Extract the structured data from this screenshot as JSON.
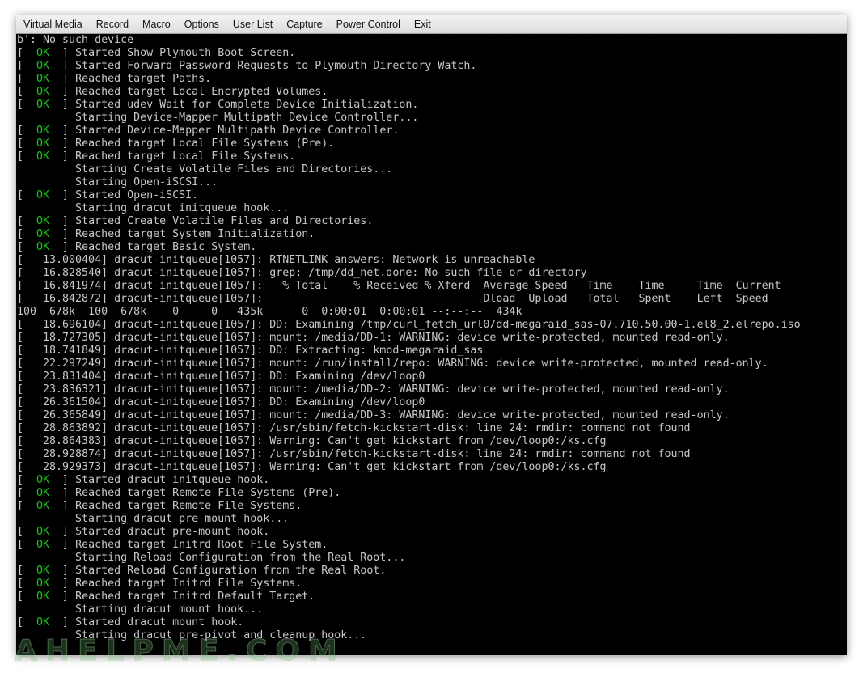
{
  "menu": [
    "Virtual Media",
    "Record",
    "Macro",
    "Options",
    "User List",
    "Capture",
    "Power Control",
    "Exit"
  ],
  "ok_label": "OK",
  "colors": {
    "ok": "#1fc01f",
    "text": "#c8c8c8",
    "background": "#000000"
  },
  "console_lines": [
    {
      "status": null,
      "text": "b': No such device"
    },
    {
      "status": "OK",
      "text": "Started Show Plymouth Boot Screen."
    },
    {
      "status": "OK",
      "text": "Started Forward Password Requests to Plymouth Directory Watch."
    },
    {
      "status": "OK",
      "text": "Reached target Paths."
    },
    {
      "status": "OK",
      "text": "Reached target Local Encrypted Volumes."
    },
    {
      "status": "OK",
      "text": "Started udev Wait for Complete Device Initialization."
    },
    {
      "status": null,
      "text": "         Starting Device-Mapper Multipath Device Controller..."
    },
    {
      "status": "OK",
      "text": "Started Device-Mapper Multipath Device Controller."
    },
    {
      "status": "OK",
      "text": "Reached target Local File Systems (Pre)."
    },
    {
      "status": "OK",
      "text": "Reached target Local File Systems."
    },
    {
      "status": null,
      "text": "         Starting Create Volatile Files and Directories..."
    },
    {
      "status": null,
      "text": "         Starting Open-iSCSI..."
    },
    {
      "status": "OK",
      "text": "Started Open-iSCSI."
    },
    {
      "status": null,
      "text": "         Starting dracut initqueue hook..."
    },
    {
      "status": "OK",
      "text": "Started Create Volatile Files and Directories."
    },
    {
      "status": "OK",
      "text": "Reached target System Initialization."
    },
    {
      "status": "OK",
      "text": "Reached target Basic System."
    },
    {
      "status": null,
      "text": "[   13.000404] dracut-initqueue[1057]: RTNETLINK answers: Network is unreachable"
    },
    {
      "status": null,
      "text": "[   16.828540] dracut-initqueue[1057]: grep: /tmp/dd_net.done: No such file or directory"
    },
    {
      "status": null,
      "text": "[   16.841974] dracut-initqueue[1057]:   % Total    % Received % Xferd  Average Speed   Time    Time     Time  Current"
    },
    {
      "status": null,
      "text": "[   16.842872] dracut-initqueue[1057]:                                  Dload  Upload   Total   Spent    Left  Speed"
    },
    {
      "status": null,
      "text": "100  678k  100  678k    0     0   435k      0  0:00:01  0:00:01 --:--:--  434k"
    },
    {
      "status": null,
      "text": "[   18.696104] dracut-initqueue[1057]: DD: Examining /tmp/curl_fetch_url0/dd-megaraid_sas-07.710.50.00-1.el8_2.elrepo.iso"
    },
    {
      "status": null,
      "text": "[   18.727305] dracut-initqueue[1057]: mount: /media/DD-1: WARNING: device write-protected, mounted read-only."
    },
    {
      "status": null,
      "text": "[   18.741849] dracut-initqueue[1057]: DD: Extracting: kmod-megaraid_sas"
    },
    {
      "status": null,
      "text": "[   22.297249] dracut-initqueue[1057]: mount: /run/install/repo: WARNING: device write-protected, mounted read-only."
    },
    {
      "status": null,
      "text": "[   23.831404] dracut-initqueue[1057]: DD: Examining /dev/loop0"
    },
    {
      "status": null,
      "text": "[   23.836321] dracut-initqueue[1057]: mount: /media/DD-2: WARNING: device write-protected, mounted read-only."
    },
    {
      "status": null,
      "text": "[   26.361504] dracut-initqueue[1057]: DD: Examining /dev/loop0"
    },
    {
      "status": null,
      "text": "[   26.365849] dracut-initqueue[1057]: mount: /media/DD-3: WARNING: device write-protected, mounted read-only."
    },
    {
      "status": null,
      "text": "[   28.863892] dracut-initqueue[1057]: /usr/sbin/fetch-kickstart-disk: line 24: rmdir: command not found"
    },
    {
      "status": null,
      "text": "[   28.864383] dracut-initqueue[1057]: Warning: Can't get kickstart from /dev/loop0:/ks.cfg"
    },
    {
      "status": null,
      "text": "[   28.928874] dracut-initqueue[1057]: /usr/sbin/fetch-kickstart-disk: line 24: rmdir: command not found"
    },
    {
      "status": null,
      "text": "[   28.929373] dracut-initqueue[1057]: Warning: Can't get kickstart from /dev/loop0:/ks.cfg"
    },
    {
      "status": "OK",
      "text": "Started dracut initqueue hook."
    },
    {
      "status": "OK",
      "text": "Reached target Remote File Systems (Pre)."
    },
    {
      "status": "OK",
      "text": "Reached target Remote File Systems."
    },
    {
      "status": null,
      "text": "         Starting dracut pre-mount hook..."
    },
    {
      "status": "OK",
      "text": "Started dracut pre-mount hook."
    },
    {
      "status": "OK",
      "text": "Reached target Initrd Root File System."
    },
    {
      "status": null,
      "text": "         Starting Reload Configuration from the Real Root..."
    },
    {
      "status": "OK",
      "text": "Started Reload Configuration from the Real Root."
    },
    {
      "status": "OK",
      "text": "Reached target Initrd File Systems."
    },
    {
      "status": "OK",
      "text": "Reached target Initrd Default Target."
    },
    {
      "status": null,
      "text": "         Starting dracut mount hook..."
    },
    {
      "status": "OK",
      "text": "Started dracut mount hook."
    },
    {
      "status": null,
      "text": "         Starting dracut pre-pivot and cleanup hook..."
    }
  ],
  "watermark": "AHELPME.COM"
}
